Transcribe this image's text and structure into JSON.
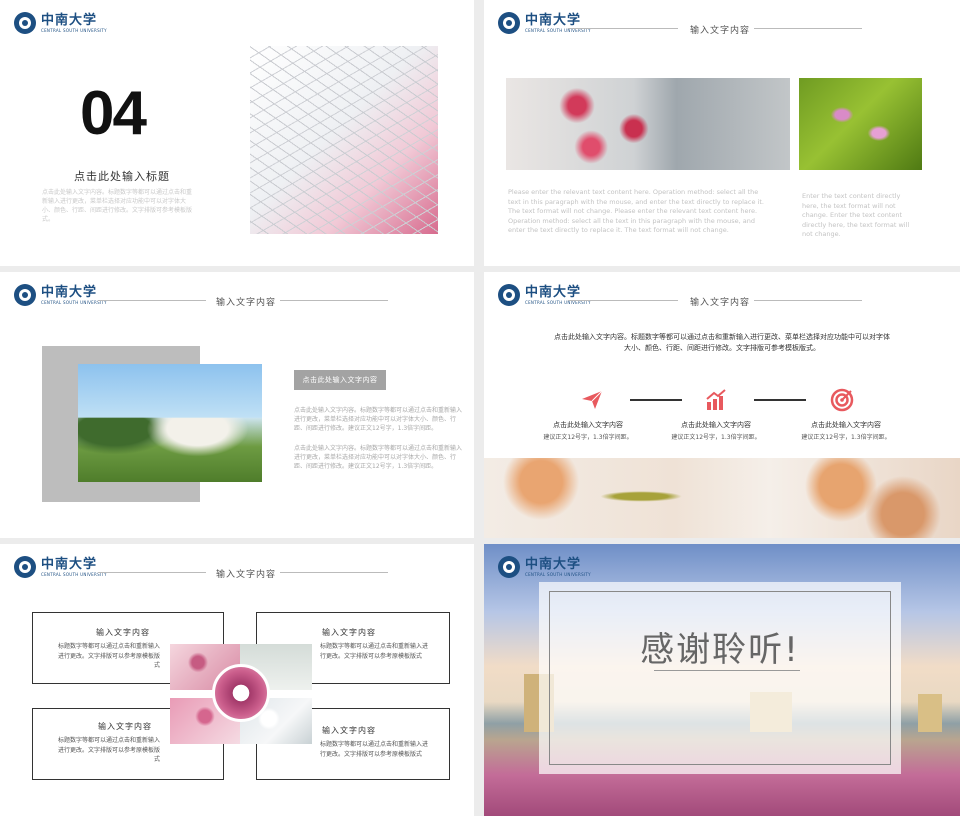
{
  "logo": {
    "name_cn": "中南大学",
    "name_en": "CENTRAL SOUTH UNIVERSITY"
  },
  "slide1": {
    "number": "04",
    "title": "点击此处输入标题",
    "body": "点击此处输入文字内容。标题数字等都可以通过点击和重新输入进行更改，菜单栏选择对应功能中可以对字体大小、颜色、行距、间距进行修改。文字排版可参考模板版式。"
  },
  "slide2": {
    "header": "输入文字内容",
    "text_left": "Please enter the relevant text content here. Operation method: select all the text in this paragraph with the mouse, and enter the text directly to replace it. The text format will not change. Please enter the relevant text content here. Operation method: select all the text in this paragraph with the mouse, and enter the text directly to replace it. The text format will not change.",
    "text_right": "Enter the text content directly here, the text format will not change. Enter the text content directly here, the text format will not change."
  },
  "slide3": {
    "header": "输入文字内容",
    "button": "点击此处输入文字内容",
    "para1": "点击此处输入文字内容。标题数字等都可以通过点击和重新输入进行更改，菜单栏选择对应功能中可以对字体大小、颜色、行距、间距进行修改。建议正文12号字，1.3倍字间距。",
    "para2": "点击此处输入文字内容。标题数字等都可以通过点击和重新输入进行更改，菜单栏选择对应功能中可以对字体大小、颜色、行距、间距进行修改。建议正文12号字，1.3倍字间距。"
  },
  "slide4": {
    "header": "输入文字内容",
    "intro_line1": "点击此处输入文字内容。标题数字等都可以通过点击和重新输入进行更改、菜单栏选择对应功能中可以对字体",
    "intro_line2": "大小、颜色、行距、间距进行修改。文字排版可参考模板版式。",
    "items": [
      {
        "title": "点击此处输入文字内容",
        "sub": "建议正文12号字，1.3倍字间距。",
        "icon": "paper-plane-icon"
      },
      {
        "title": "点击此处输入文字内容",
        "sub": "建议正文12号字，1.3倍字间距。",
        "icon": "bar-chart-growth-icon"
      },
      {
        "title": "点击此处输入文字内容",
        "sub": "建议正文12号字，1.3倍字间距。",
        "icon": "target-icon"
      }
    ],
    "accent": "#e8595e"
  },
  "slide5": {
    "header": "输入文字内容",
    "boxes": [
      {
        "title": "输入文字内容",
        "body": "标题数字等都可以通过点击和重新输入进行更改。文字排版可以参考原模板版式"
      },
      {
        "title": "输入文字内容",
        "body": "标题数字等都可以通过点击和重新输入进行更改。文字排版可以参考原模板版式"
      },
      {
        "title": "输入文字内容",
        "body": "标题数字等都可以通过点击和重新输入进行更改。文字排版可以参考原模板版式"
      },
      {
        "title": "输入文字内容",
        "body": "标题数字等都可以通过点击和重新输入进行更改。文字排版可以参考原模板版式"
      }
    ]
  },
  "slide6": {
    "thanks": "感谢聆听!"
  }
}
